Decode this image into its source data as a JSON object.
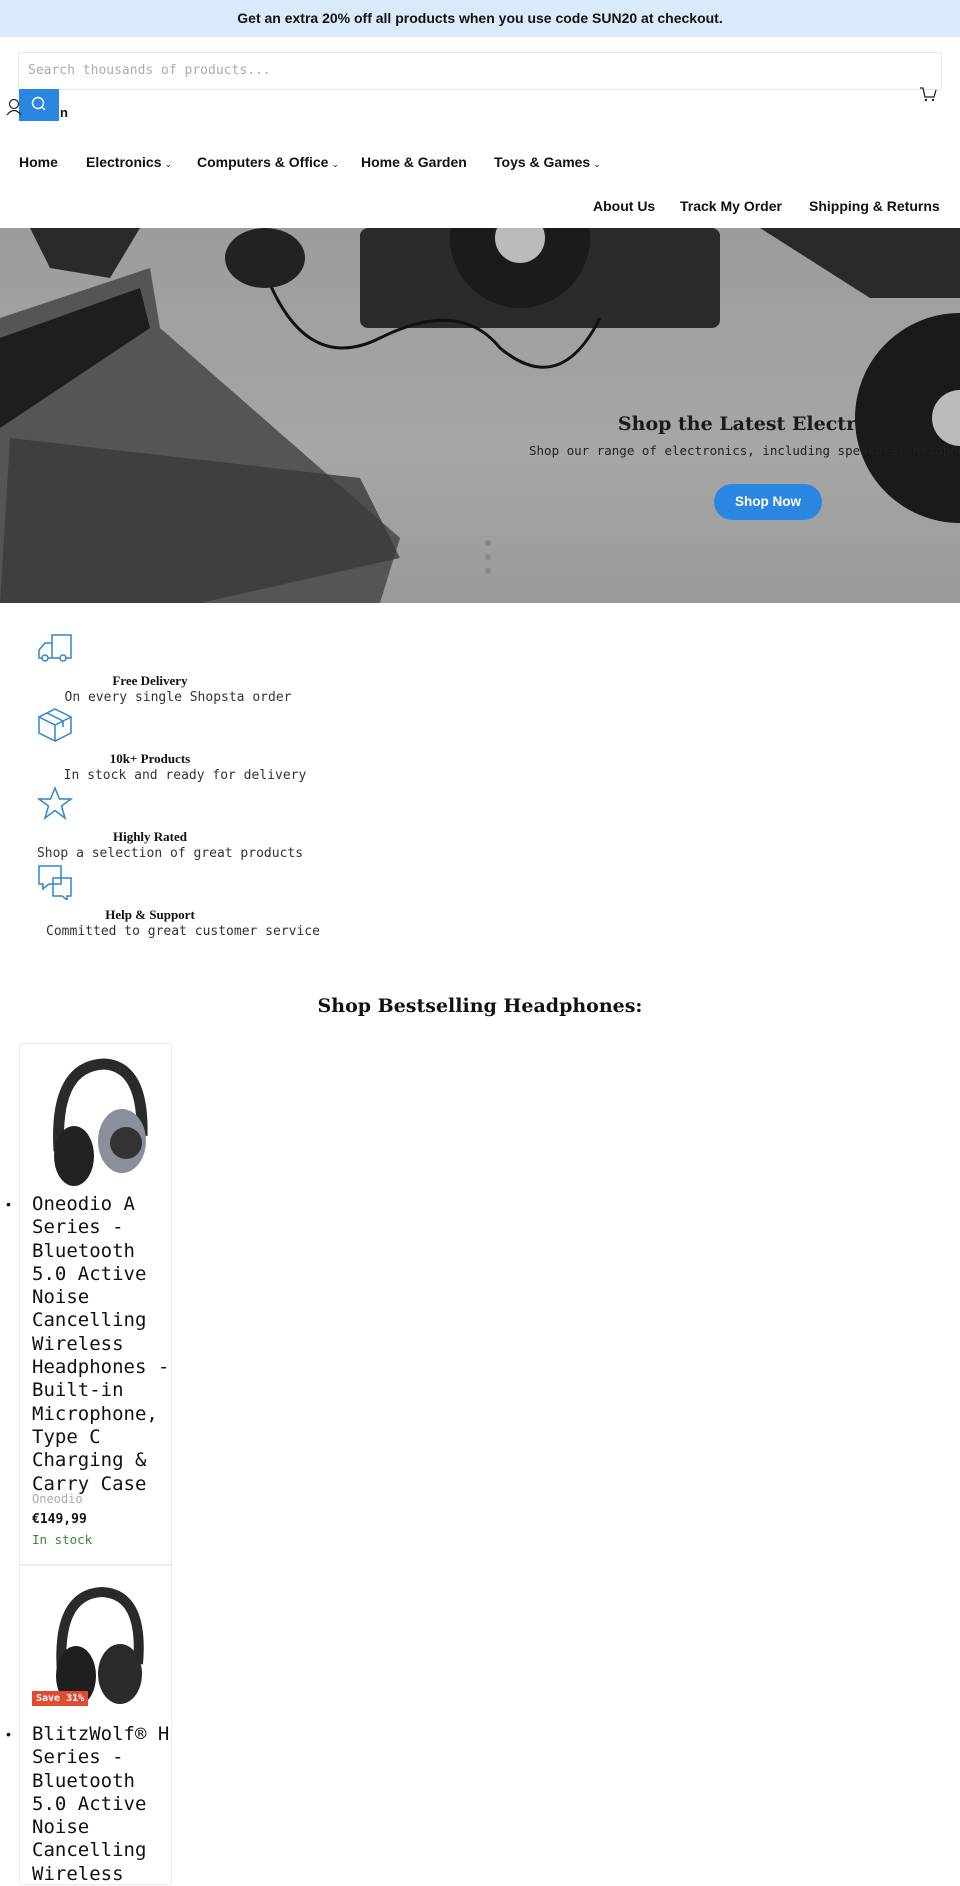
{
  "promo": {
    "text": "Get an extra 20% off all products when you use code SUN20 at checkout."
  },
  "header": {
    "search_placeholder": "Search thousands of products...",
    "account_label_fragment": "n",
    "icons": {
      "search": "search-icon",
      "account": "user-icon",
      "cart": "cart-icon"
    }
  },
  "nav": {
    "primary": [
      {
        "label": "Home"
      },
      {
        "label": "Electronics",
        "dropdown": true
      },
      {
        "label": "Computers & Office",
        "dropdown": true
      },
      {
        "label": "Home & Garden"
      },
      {
        "label": "Toys & Games",
        "dropdown": true
      }
    ],
    "secondary": [
      {
        "label": "About Us"
      },
      {
        "label": "Track My Order"
      },
      {
        "label": "Shipping & Returns"
      }
    ],
    "chevron": "⌄"
  },
  "hero": {
    "title": "Shop the Latest Electronics",
    "subtitle": "Shop our range of electronics, including speakers, headphones and more",
    "button": "Shop Now",
    "accent": "#2a86e0",
    "slides": 3
  },
  "features": [
    {
      "icon": "truck-icon",
      "title": "Free Delivery",
      "desc": "On every single Shopsta order"
    },
    {
      "icon": "box-icon",
      "title": "10k+ Products",
      "desc": "In stock and ready for delivery"
    },
    {
      "icon": "star-icon",
      "title": "Highly Rated",
      "desc": "Shop a selection of great products"
    },
    {
      "icon": "chat-icon",
      "title": "Help & Support",
      "desc": "Committed to great customer service"
    }
  ],
  "section": {
    "title": "Shop Bestselling Headphones:"
  },
  "products": [
    {
      "title": "Oneodio A Series - Bluetooth 5.0 Active Noise Cancelling Wireless Headphones - Built-in Microphone, Type C Charging & Carry Case",
      "vendor": "Oneodio",
      "price": "€149,99",
      "stock": "In stock"
    },
    {
      "badge": "Save 31%",
      "title": "BlitzWolf® H Series - Bluetooth 5.0 Active Noise Cancelling Wireless"
    }
  ]
}
